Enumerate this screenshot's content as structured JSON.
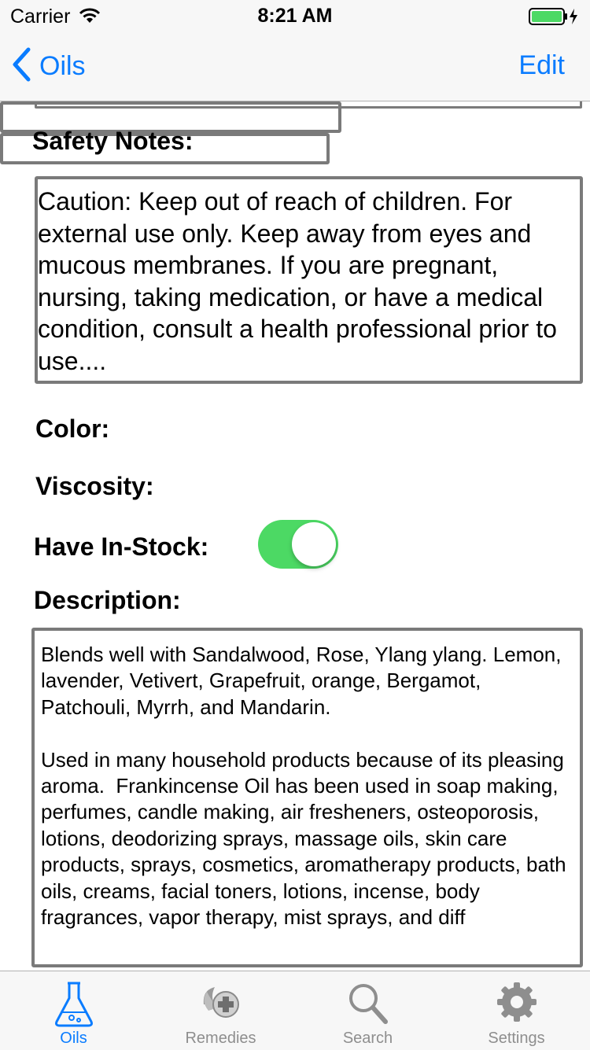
{
  "status_bar": {
    "carrier": "Carrier",
    "time": "8:21 AM"
  },
  "nav": {
    "back_label": "Oils",
    "edit_label": "Edit"
  },
  "form": {
    "safety_label": "Safety Notes:",
    "safety_text": "Caution: Keep out of reach of children. For external use only. Keep away from eyes and mucous membranes. If you are pregnant, nursing, taking medication, or have a medical condition, consult a health professional prior to use....",
    "color_label": "Color:",
    "color_value": "",
    "viscosity_label": "Viscosity:",
    "viscosity_value": "",
    "instock_label": "Have In-Stock:",
    "instock_on": true,
    "description_label": "Description:",
    "description_text": "Blends well with Sandalwood, Rose, Ylang ylang. Lemon, lavender, Vetivert, Grapefruit, orange, Bergamot, Patchouli, Myrrh, and Mandarin.\n\nUsed in many household products because of its pleasing aroma.  Frankincense Oil has been used in soap making, perfumes, candle making, air fresheners, osteoporosis, lotions, deodorizing sprays, massage oils, skin care products, sprays, cosmetics, aromatherapy products, bath oils, creams, facial toners, lotions, incense, body fragrances, vapor therapy, mist sprays, and diff"
  },
  "tabs": [
    {
      "label": "Oils",
      "icon": "flask-icon",
      "active": true
    },
    {
      "label": "Remedies",
      "icon": "remedies-icon",
      "active": false
    },
    {
      "label": "Search",
      "icon": "search-icon",
      "active": false
    },
    {
      "label": "Settings",
      "icon": "gear-icon",
      "active": false
    }
  ],
  "colors": {
    "accent": "#0a7cff",
    "toggle_on": "#4cd964",
    "border": "#7a7a7a",
    "tab_inactive": "#8e8e8e"
  }
}
